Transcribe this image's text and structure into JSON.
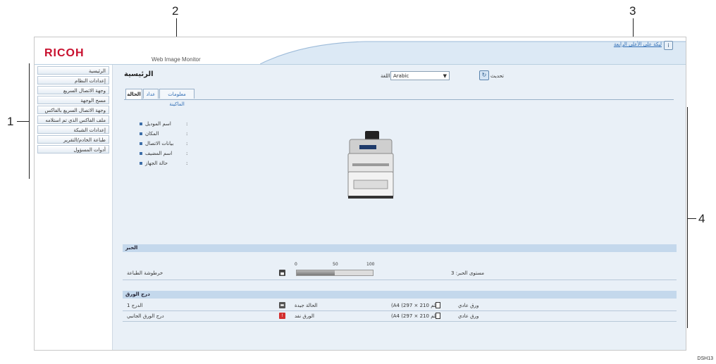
{
  "header": {
    "logo": "RICOH",
    "product": "Web Image Monitor",
    "help_link": "ليكة على الأعلى الرابعة"
  },
  "sidebar": {
    "items": [
      {
        "label": "الرئيسية"
      },
      {
        "label": "إعدادات النظام"
      },
      {
        "label": "وجهة الاتصال السريع"
      },
      {
        "label": "مسح الوجهة"
      },
      {
        "label": "وجهة الاتصال السريع بالفاكس"
      },
      {
        "label": "ملف الفاكس الذي تم استلامه"
      },
      {
        "label": "إعدادات الشبكة"
      },
      {
        "label": "طباعة الخادم/التقرير"
      },
      {
        "label": "أدوات المسؤول"
      }
    ]
  },
  "main": {
    "page_title": "الرئيسية",
    "language_label": "اللغة",
    "language_value": "Arabic",
    "refresh_label": "تحديث",
    "tabs": [
      {
        "label": "الحالة"
      },
      {
        "label": "عداد"
      },
      {
        "label": "معلومات الماكينة"
      }
    ],
    "device_info": [
      {
        "label": "اسم الموديل"
      },
      {
        "label": "المكان"
      },
      {
        "label": "بيانات الاتصال"
      },
      {
        "label": "اسم المضيف"
      },
      {
        "label": "حالة الجهاز"
      }
    ],
    "toner_section": {
      "title": "الحبر",
      "row_label": "خرطوشة الطباعة",
      "status": "مستوى الحبر: 3",
      "scale": [
        "0",
        "50",
        "100"
      ],
      "level_percent": 50
    },
    "paper_section": {
      "title": "درج الورق",
      "trays": [
        {
          "name": "الدرج 1",
          "status": "الحالة جيدة",
          "size": "(A4 (297 × 210 ملم",
          "type": "ورق عادي",
          "error": false
        },
        {
          "name": "درج الورق الجانبي",
          "status": "الورق نفد",
          "size": "(A4 (297 × 210 ملم",
          "type": "ورق عادي",
          "error": true
        }
      ]
    }
  },
  "callouts": [
    "1",
    "2",
    "3",
    "4"
  ],
  "figure_code": "DSH13"
}
